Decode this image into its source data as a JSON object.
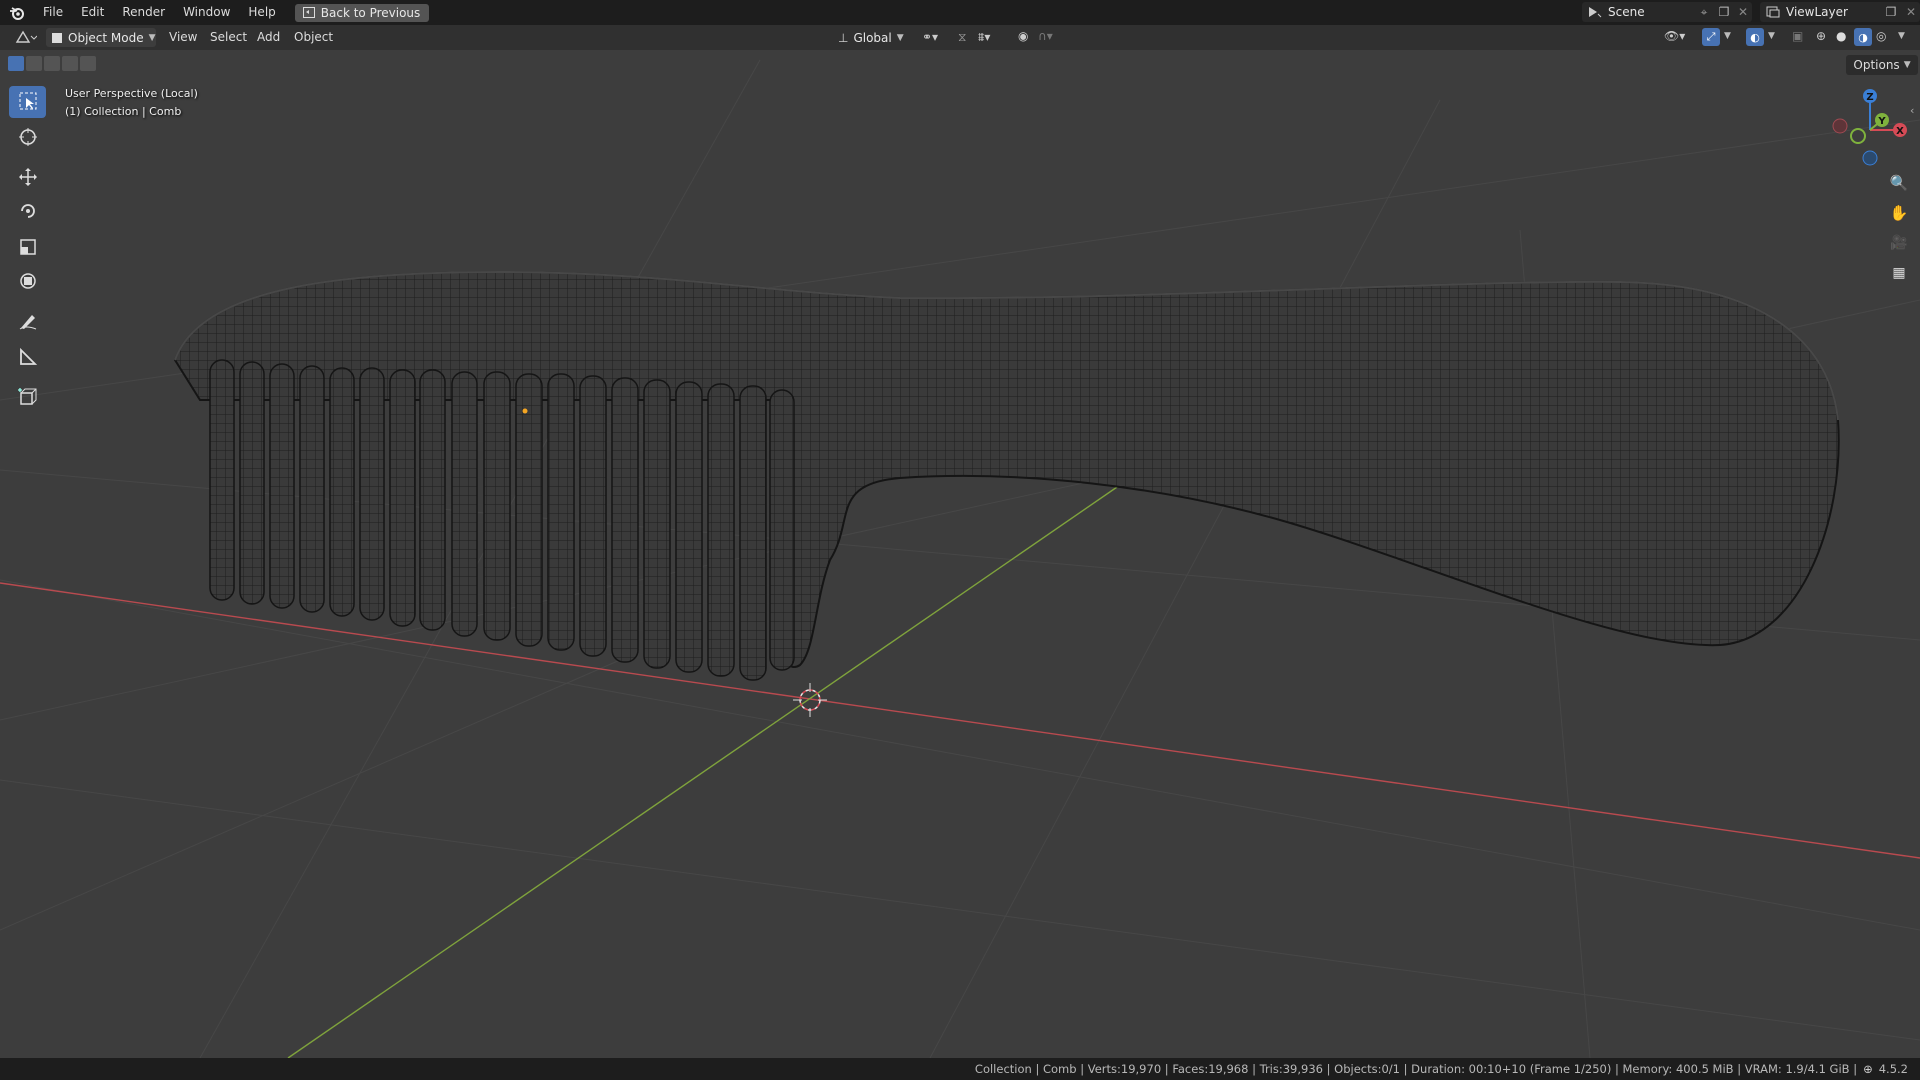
{
  "menubar": {
    "items": [
      "File",
      "Edit",
      "Render",
      "Window",
      "Help"
    ],
    "back_label": "Back to Previous",
    "scene": "Scene",
    "view_layer": "ViewLayer"
  },
  "viewport_header": {
    "mode": "Object Mode",
    "menus": [
      "View",
      "Select",
      "Add",
      "Object"
    ],
    "orientation": "Global",
    "options_label": "Options"
  },
  "viewport": {
    "perspective_text": "User Perspective (Local)",
    "collection_text": "(1) Collection | Comb",
    "axes": {
      "x": "X",
      "y": "Y",
      "z": "Z"
    }
  },
  "statusbar": {
    "text": "Collection | Comb | Verts:19,970 | Faces:19,968 | Tris:39,936 | Objects:0/1 | Duration: 00:10+10 (Frame 1/250) | Memory: 400.5 MiB | VRAM: 1.9/4.1 GiB |",
    "version": "4.5.2"
  },
  "colors": {
    "accent": "#4772b3",
    "x_axis": "#d64b56",
    "y_axis": "#7fb23d",
    "z_axis": "#3a7fd6"
  }
}
